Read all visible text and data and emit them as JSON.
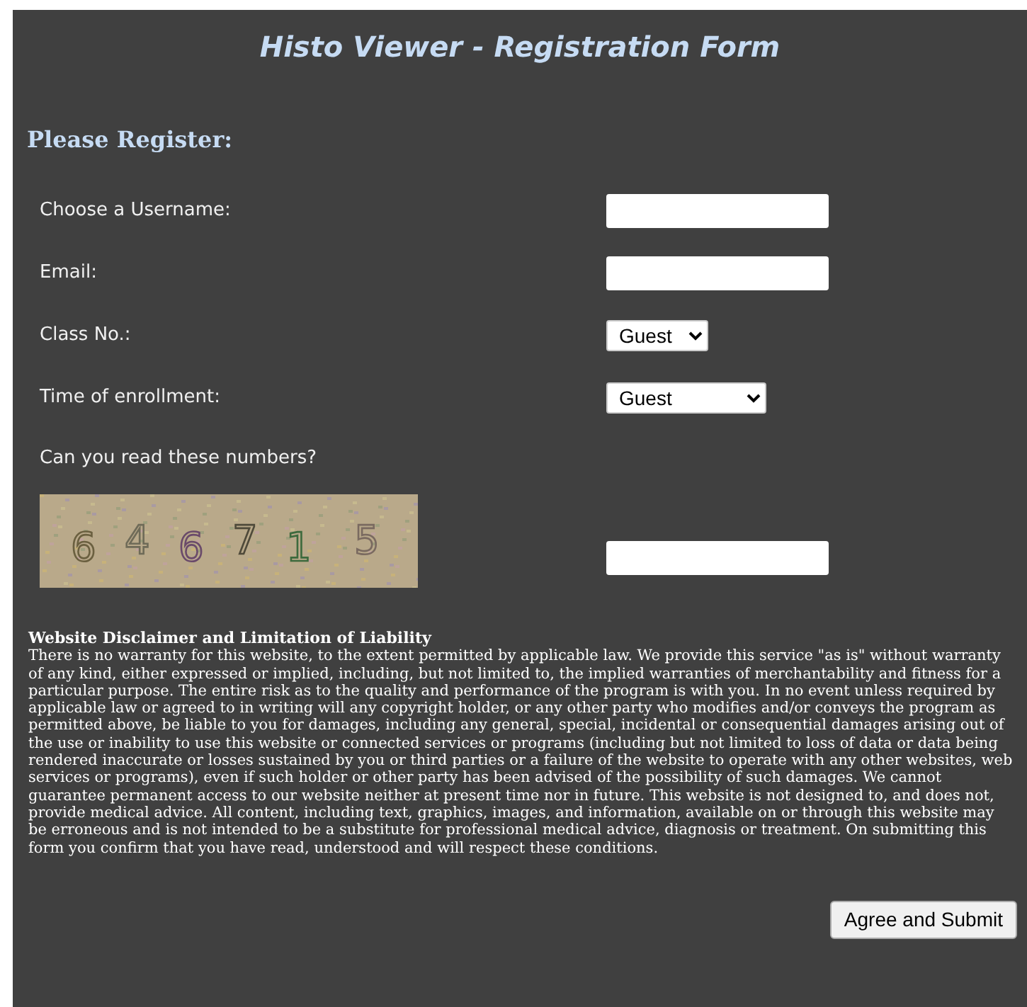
{
  "title": "Histo Viewer - Registration Form",
  "heading": "Please Register:",
  "fields": [
    {
      "kind": "text",
      "label": "Choose a Username:"
    },
    {
      "kind": "text",
      "label": "Email:"
    },
    {
      "kind": "select",
      "label": "Class No.:",
      "value": "Guest",
      "wide": false
    },
    {
      "kind": "select",
      "label": "Time of enrollment:",
      "value": "Guest",
      "wide": true
    }
  ],
  "captcha": {
    "question": "Can you read these numbers?",
    "digits": [
      "6",
      "4",
      "6",
      "7",
      "1",
      "5"
    ]
  },
  "disclaimer": {
    "title": "Website Disclaimer and Limitation of Liability",
    "body": "There is no warranty for this website, to the extent permitted by applicable law. We provide this service \"as is\" without warranty of any kind, either expressed or implied, including, but not limited to, the implied warranties of merchantability and fitness for a particular purpose. The entire risk as to the quality and performance of the program is with you. In no event unless required by applicable law or agreed to in writing will any copyright holder, or any other party who modifies and/or conveys the program as permitted above, be liable to you for damages, including any general, special, incidental or consequential damages arising out of the use or inability to use this website or connected services or programs (including but not limited to loss of data or data being rendered inaccurate or losses sustained by you or third parties or a failure of the website to operate with any other websites, web services or programs), even if such holder or other party has been advised of the possibility of such damages. We cannot guarantee permanent access to our website neither at present time nor in future. This website is not designed to, and does not, provide medical advice. All content, including text, graphics, images, and information, available on or through this website may be erroneous and is not intended to be a substitute for professional medical advice, diagnosis or treatment. On submitting this form you confirm that you have read, understood and will respect these conditions."
  },
  "submit": "Agree and Submit"
}
